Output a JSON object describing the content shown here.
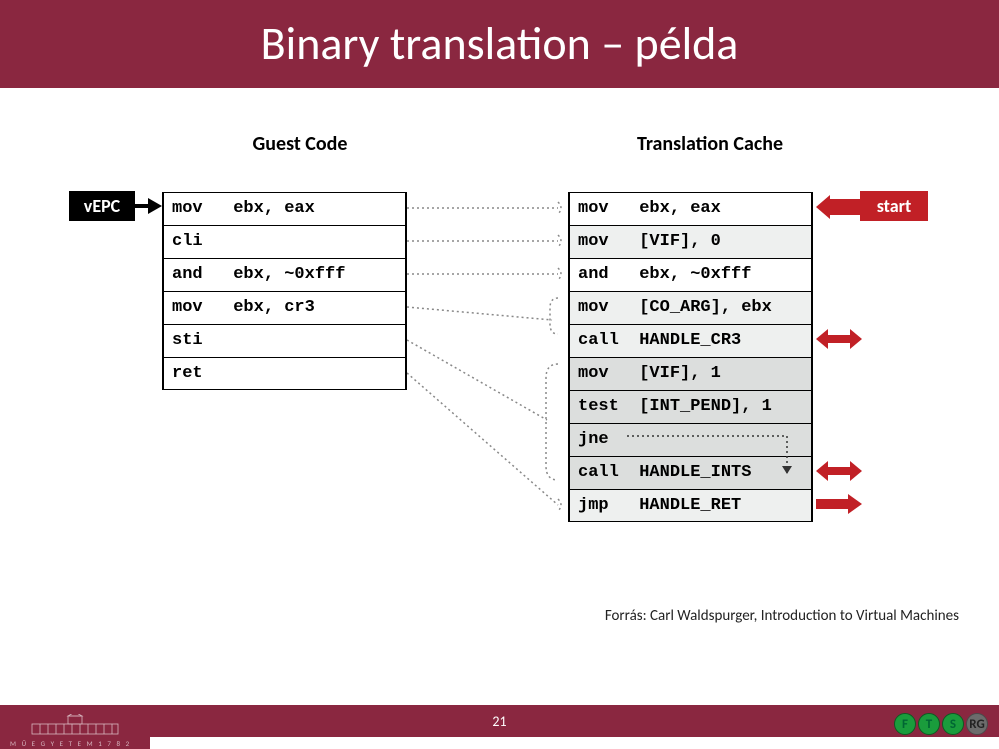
{
  "title": "Binary translation – példa",
  "headings": {
    "guest": "Guest Code",
    "trans": "Translation Cache"
  },
  "labels": {
    "vepc": "vEPC",
    "start": "start"
  },
  "guest_code": [
    "mov   ebx, eax",
    "cli",
    "and   ebx, ~0xfff",
    "mov   ebx, cr3",
    "sti",
    "ret"
  ],
  "translation_cache": [
    {
      "text": "mov   ebx, eax",
      "shade": ""
    },
    {
      "text": "mov   [VIF], 0",
      "shade": "g1"
    },
    {
      "text": "and   ebx, ~0xfff",
      "shade": ""
    },
    {
      "text": "mov   [CO_ARG], ebx",
      "shade": "g1"
    },
    {
      "text": "call  HANDLE_CR3",
      "shade": "g1"
    },
    {
      "text": "mov   [VIF], 1",
      "shade": "g2"
    },
    {
      "text": "test  [INT_PEND], 1",
      "shade": "g2"
    },
    {
      "text": "jne",
      "shade": "g2"
    },
    {
      "text": "call  HANDLE_INTS",
      "shade": "g2"
    },
    {
      "text": "jmp   HANDLE_RET",
      "shade": "g1"
    }
  ],
  "chart_data": {
    "type": "table",
    "title": "Binary translation – példa",
    "guest_code_rows": [
      [
        "mov",
        "ebx, eax"
      ],
      [
        "cli",
        ""
      ],
      [
        "and",
        "ebx, ~0xfff"
      ],
      [
        "mov",
        "ebx, cr3"
      ],
      [
        "sti",
        ""
      ],
      [
        "ret",
        ""
      ]
    ],
    "translation_cache_rows": [
      [
        "mov",
        "ebx, eax"
      ],
      [
        "mov",
        "[VIF], 0"
      ],
      [
        "and",
        "ebx, ~0xfff"
      ],
      [
        "mov",
        "[CO_ARG], ebx"
      ],
      [
        "call",
        "HANDLE_CR3"
      ],
      [
        "mov",
        "[VIF], 1"
      ],
      [
        "test",
        "[INT_PEND], 1"
      ],
      [
        "jne",
        ""
      ],
      [
        "call",
        "HANDLE_INTS"
      ],
      [
        "jmp",
        "HANDLE_RET"
      ]
    ],
    "mappings": [
      {
        "guest_row": 0,
        "trans_rows": [
          0
        ]
      },
      {
        "guest_row": 1,
        "trans_rows": [
          1
        ]
      },
      {
        "guest_row": 2,
        "trans_rows": [
          2
        ]
      },
      {
        "guest_row": 3,
        "trans_rows": [
          3,
          4
        ]
      },
      {
        "guest_row": 4,
        "trans_rows": [
          5,
          6,
          7,
          8
        ]
      },
      {
        "guest_row": 5,
        "trans_rows": [
          9
        ]
      }
    ],
    "vepc_points_to_guest_row": 0,
    "start_points_to_trans_row": 0,
    "external_call_arrows_trans_rows": [
      4,
      8,
      9
    ],
    "jne_internal_branch": {
      "from_trans_row": 7,
      "to_trans_row": 8
    }
  },
  "source_credit": "Forrás: Carl Waldspurger, Introduction to Virtual Machines",
  "page_number": "21",
  "footer_logo_text": "M Ű E G Y E T E M  1 7 8 2",
  "footer_icons": [
    "F",
    "T",
    "S",
    "RG"
  ]
}
